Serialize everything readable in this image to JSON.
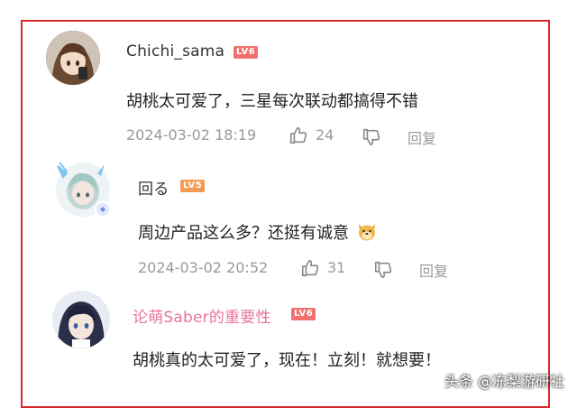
{
  "colors": {
    "frame": "#d9272e",
    "lv6": "#f0716d",
    "lv5": "#f59a52",
    "pink_username": "#e8749c",
    "meta": "#9a9a9a"
  },
  "comments": [
    {
      "username": "Chichi_sama",
      "level": "LV6",
      "text": "胡桃太可爱了，三星每次联动都搞得不错",
      "time": "2024-03-02 18:19",
      "likes": "24",
      "reply_label": "回复"
    },
    {
      "username": "回る",
      "level": "LV5",
      "text": "周边产品这么多？还挺有诚意",
      "emoji": "dog-emoji",
      "time": "2024-03-02 20:52",
      "likes": "31",
      "reply_label": "回复"
    },
    {
      "username": "论萌Saber的重要性",
      "level": "LV6",
      "text": "胡桃真的太可爱了，现在！立刻！就想要！"
    }
  ],
  "watermark": "头条 @冻梨游研社"
}
